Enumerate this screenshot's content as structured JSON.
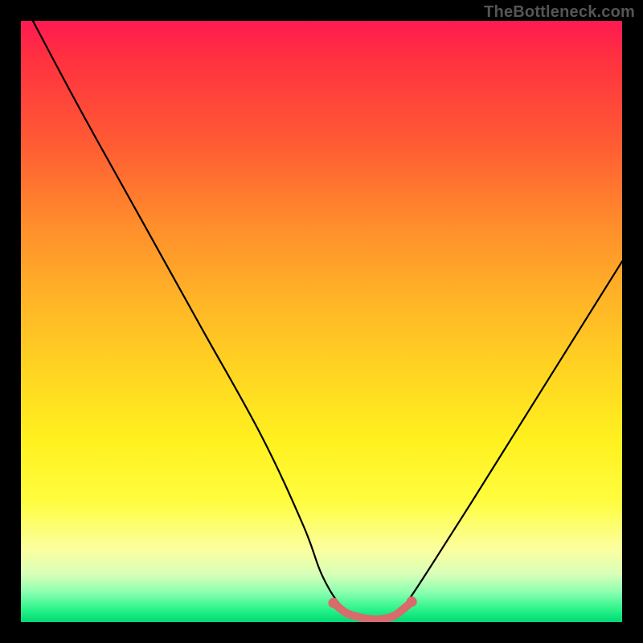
{
  "watermark": "TheBottleneck.com",
  "colors": {
    "background": "#000000",
    "curve_stroke": "#000000",
    "highlight_stroke": "#d86b6b",
    "gradient_top": "#ff1a52",
    "gradient_bottom": "#00d874"
  },
  "chart_data": {
    "type": "line",
    "title": "",
    "xlabel": "",
    "ylabel": "",
    "xlim": [
      0,
      100
    ],
    "ylim": [
      0,
      100
    ],
    "grid": false,
    "legend": false,
    "series": [
      {
        "name": "bottleneck-curve",
        "x": [
          2,
          10,
          20,
          30,
          40,
          47,
          50,
          53,
          56,
          58,
          60,
          62,
          64,
          68,
          75,
          85,
          95,
          100
        ],
        "y": [
          100,
          85,
          67,
          49,
          31,
          16,
          8,
          3,
          1,
          0.5,
          0.5,
          1,
          3,
          9,
          20,
          36,
          52,
          60
        ]
      }
    ],
    "highlight": {
      "name": "optimal-range",
      "x": [
        52,
        54,
        56,
        58,
        60,
        62,
        64,
        65
      ],
      "y": [
        3.2,
        1.6,
        0.9,
        0.5,
        0.5,
        1.0,
        2.5,
        3.4
      ]
    }
  }
}
